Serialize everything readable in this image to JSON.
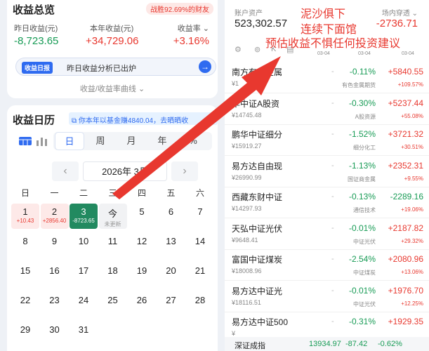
{
  "summary": {
    "title": "收益总览",
    "badge": "战胜92.69%的财友",
    "headers": {
      "yesterday": "昨日收益(元)",
      "year": "本年收益(元)",
      "rate": "收益率"
    },
    "values": {
      "yesterday": "-8,723.65",
      "year": "+34,729.06",
      "rate": "+3.16%"
    },
    "ai_tag": "收益日报",
    "ai_text": "昨日收益分析已出炉",
    "curve_link": "收益/收益率曲线"
  },
  "calendar": {
    "title": "收益日历",
    "banner": "你本年以基金赚4840.04，去晒晒收",
    "tabs": [
      "日",
      "周",
      "月",
      "年",
      "%"
    ],
    "active_tab": "日",
    "month_label": "2026年 3月",
    "weekdays": [
      "日",
      "一",
      "二",
      "三",
      "四",
      "五",
      "六"
    ],
    "rows": [
      [
        {
          "d": "1",
          "sub": "+10.43",
          "kind": "up"
        },
        {
          "d": "2",
          "sub": "+2856.40",
          "kind": "up"
        },
        {
          "d": "3",
          "sub": "-8723.65",
          "kind": "sel"
        },
        {
          "d": "今",
          "sub": "未更新",
          "kind": "today"
        },
        {
          "d": "5"
        },
        {
          "d": "6"
        },
        {
          "d": "7"
        }
      ],
      [
        {
          "d": "8"
        },
        {
          "d": "9"
        },
        {
          "d": "10"
        },
        {
          "d": "11"
        },
        {
          "d": "12"
        },
        {
          "d": "13"
        },
        {
          "d": "14"
        }
      ],
      [
        {
          "d": "15"
        },
        {
          "d": "16"
        },
        {
          "d": "17"
        },
        {
          "d": "18"
        },
        {
          "d": "19"
        },
        {
          "d": "20"
        },
        {
          "d": "21"
        }
      ],
      [
        {
          "d": "22"
        },
        {
          "d": "23"
        },
        {
          "d": "24"
        },
        {
          "d": "25"
        },
        {
          "d": "26"
        },
        {
          "d": "27"
        },
        {
          "d": "28"
        }
      ],
      [
        {
          "d": "29"
        },
        {
          "d": "30"
        },
        {
          "d": "31"
        }
      ]
    ]
  },
  "account": {
    "assets_label": "账户资产",
    "assets_value": "523,302.57",
    "offsite_label": "场内穿透",
    "offsite_value": "-2736.71",
    "dates": [
      "03-04",
      "03-04",
      "03-04"
    ]
  },
  "funds": [
    {
      "name": "南方有色金属",
      "amount": "¥1",
      "pct": "-0.11%",
      "cat": "有色金属期货",
      "val": "+5840.55",
      "sub": "+109.57%",
      "pct_color": "green",
      "val_color": "red",
      "sub_color": "red"
    },
    {
      "name": "华中证A股资",
      "amount": "¥14745.48",
      "pct": "-0.30%",
      "cat": "A股资源",
      "val": "+5237.44",
      "sub": "+55.08%",
      "pct_color": "green",
      "val_color": "red",
      "sub_color": "red"
    },
    {
      "name": "鹏华中证细分",
      "amount": "¥15919.27",
      "pct": "-1.52%",
      "cat": "细分化工",
      "val": "+3721.32",
      "sub": "+30.51%",
      "pct_color": "green",
      "val_color": "red",
      "sub_color": "red"
    },
    {
      "name": "易方达自由现",
      "amount": "¥26990.99",
      "pct": "-1.13%",
      "cat": "国证商金属",
      "val": "+2352.31",
      "sub": "+9.55%",
      "pct_color": "green",
      "val_color": "red",
      "sub_color": "red"
    },
    {
      "name": "西藏东财中证",
      "amount": "¥14297.93",
      "pct": "-0.13%",
      "cat": "通信技术",
      "val": "-2289.16",
      "sub": "+19.06%",
      "pct_color": "green",
      "val_color": "green",
      "sub_color": "red"
    },
    {
      "name": "天弘中证光伏",
      "amount": "¥9648.41",
      "pct": "-0.01%",
      "cat": "中证光伏",
      "val": "+2187.82",
      "sub": "+29.32%",
      "pct_color": "green",
      "val_color": "red",
      "sub_color": "red"
    },
    {
      "name": "富国中证煤炭",
      "amount": "¥18008.96",
      "pct": "-2.54%",
      "cat": "中证煤炭",
      "val": "+2080.96",
      "sub": "+13.06%",
      "pct_color": "green",
      "val_color": "red",
      "sub_color": "red"
    },
    {
      "name": "易方达中证光",
      "amount": "¥18116.51",
      "pct": "-0.01%",
      "cat": "中证光伏",
      "val": "+1976.70",
      "sub": "+12.25%",
      "pct_color": "green",
      "val_color": "red",
      "sub_color": "red"
    },
    {
      "name": "易方达中证500",
      "amount": "¥",
      "pct": "-0.31%",
      "cat": "",
      "val": "+1929.35",
      "sub": "",
      "pct_color": "green",
      "val_color": "red",
      "sub_color": "red"
    }
  ],
  "ticker": {
    "name": "深证成指",
    "value": "13934.97",
    "change": "-87.42",
    "pct": "-0.62%"
  },
  "overlay": {
    "line1": "泥沙俱下",
    "line2": "连续下面馆",
    "line3": "预估收益不惧任何投资建议"
  },
  "icons": {
    "calendar_view": "calendar-grid-icon",
    "bar_view": "bar-chart-icon",
    "prev": "chevron-left-icon",
    "next": "chevron-right-icon",
    "ai_go": "arrow-right-icon",
    "banner": "share-icon"
  },
  "colors": {
    "up": "#e8382f",
    "down": "#179b55",
    "accent": "#2f6bf0",
    "selected_day": "#228a60"
  }
}
